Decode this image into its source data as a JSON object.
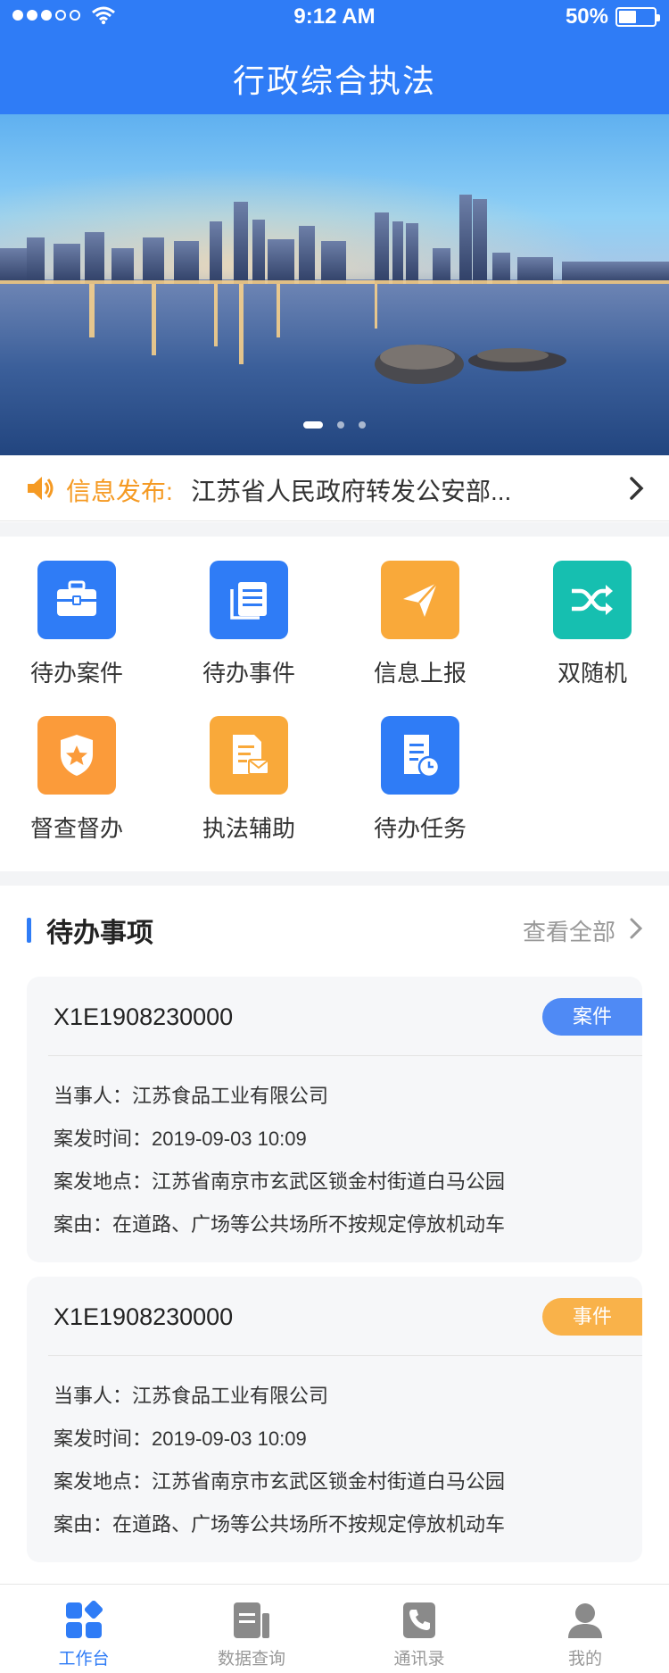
{
  "status_bar": {
    "time": "9:12 AM",
    "battery": "50%",
    "battery_level": 0.5
  },
  "header": {
    "title": "行政综合执法"
  },
  "banner": {
    "slides": 3,
    "active_slide": 1
  },
  "notice": {
    "icon": "speaker-icon",
    "label": "信息发布:",
    "text": "江苏省人民政府转发公安部..."
  },
  "grid": [
    {
      "label": "待办案件",
      "icon": "briefcase-icon",
      "color": "#2f7cf6"
    },
    {
      "label": "待办事件",
      "icon": "document-list-icon",
      "color": "#2f7cf6"
    },
    {
      "label": "信息上报",
      "icon": "paper-plane-icon",
      "color": "#f9a93a"
    },
    {
      "label": "双随机",
      "icon": "shuffle-icon",
      "color": "#16bfb0"
    },
    {
      "label": "督查督办",
      "icon": "shield-star-icon",
      "color": "#fb9b3a"
    },
    {
      "label": "执法辅助",
      "icon": "form-mail-icon",
      "color": "#f9a93a"
    },
    {
      "label": "待办任务",
      "icon": "clipboard-clock-icon",
      "color": "#2f7cf6"
    }
  ],
  "todo": {
    "title": "待办事项",
    "view_all": "查看全部",
    "items": [
      {
        "id": "X1E1908230000",
        "badge": "案件",
        "badge_color": "#4f8af5",
        "party": "当事人：江苏食品工业有限公司",
        "time": "案发时间：2019-09-03 10:09",
        "location": "案发地点：江苏省南京市玄武区锁金村街道白马公园",
        "reason": "案由：在道路、广场等公共场所不按规定停放机动车"
      },
      {
        "id": "X1E1908230000",
        "badge": "事件",
        "badge_color": "#f9b24a",
        "party": "当事人：江苏食品工业有限公司",
        "time": "案发时间：2019-09-03 10:09",
        "location": "案发地点：江苏省南京市玄武区锁金村街道白马公园",
        "reason": "案由：在道路、广场等公共场所不按规定停放机动车"
      }
    ]
  },
  "tabbar": [
    {
      "label": "工作台",
      "icon": "workbench-icon",
      "active": true
    },
    {
      "label": "数据查询",
      "icon": "data-query-icon",
      "active": false
    },
    {
      "label": "通讯录",
      "icon": "contacts-phone-icon",
      "active": false
    },
    {
      "label": "我的",
      "icon": "profile-icon",
      "active": false
    }
  ],
  "colors": {
    "primary": "#2f7cf6",
    "accent_orange": "#f59a23",
    "teal": "#16bfb0"
  }
}
